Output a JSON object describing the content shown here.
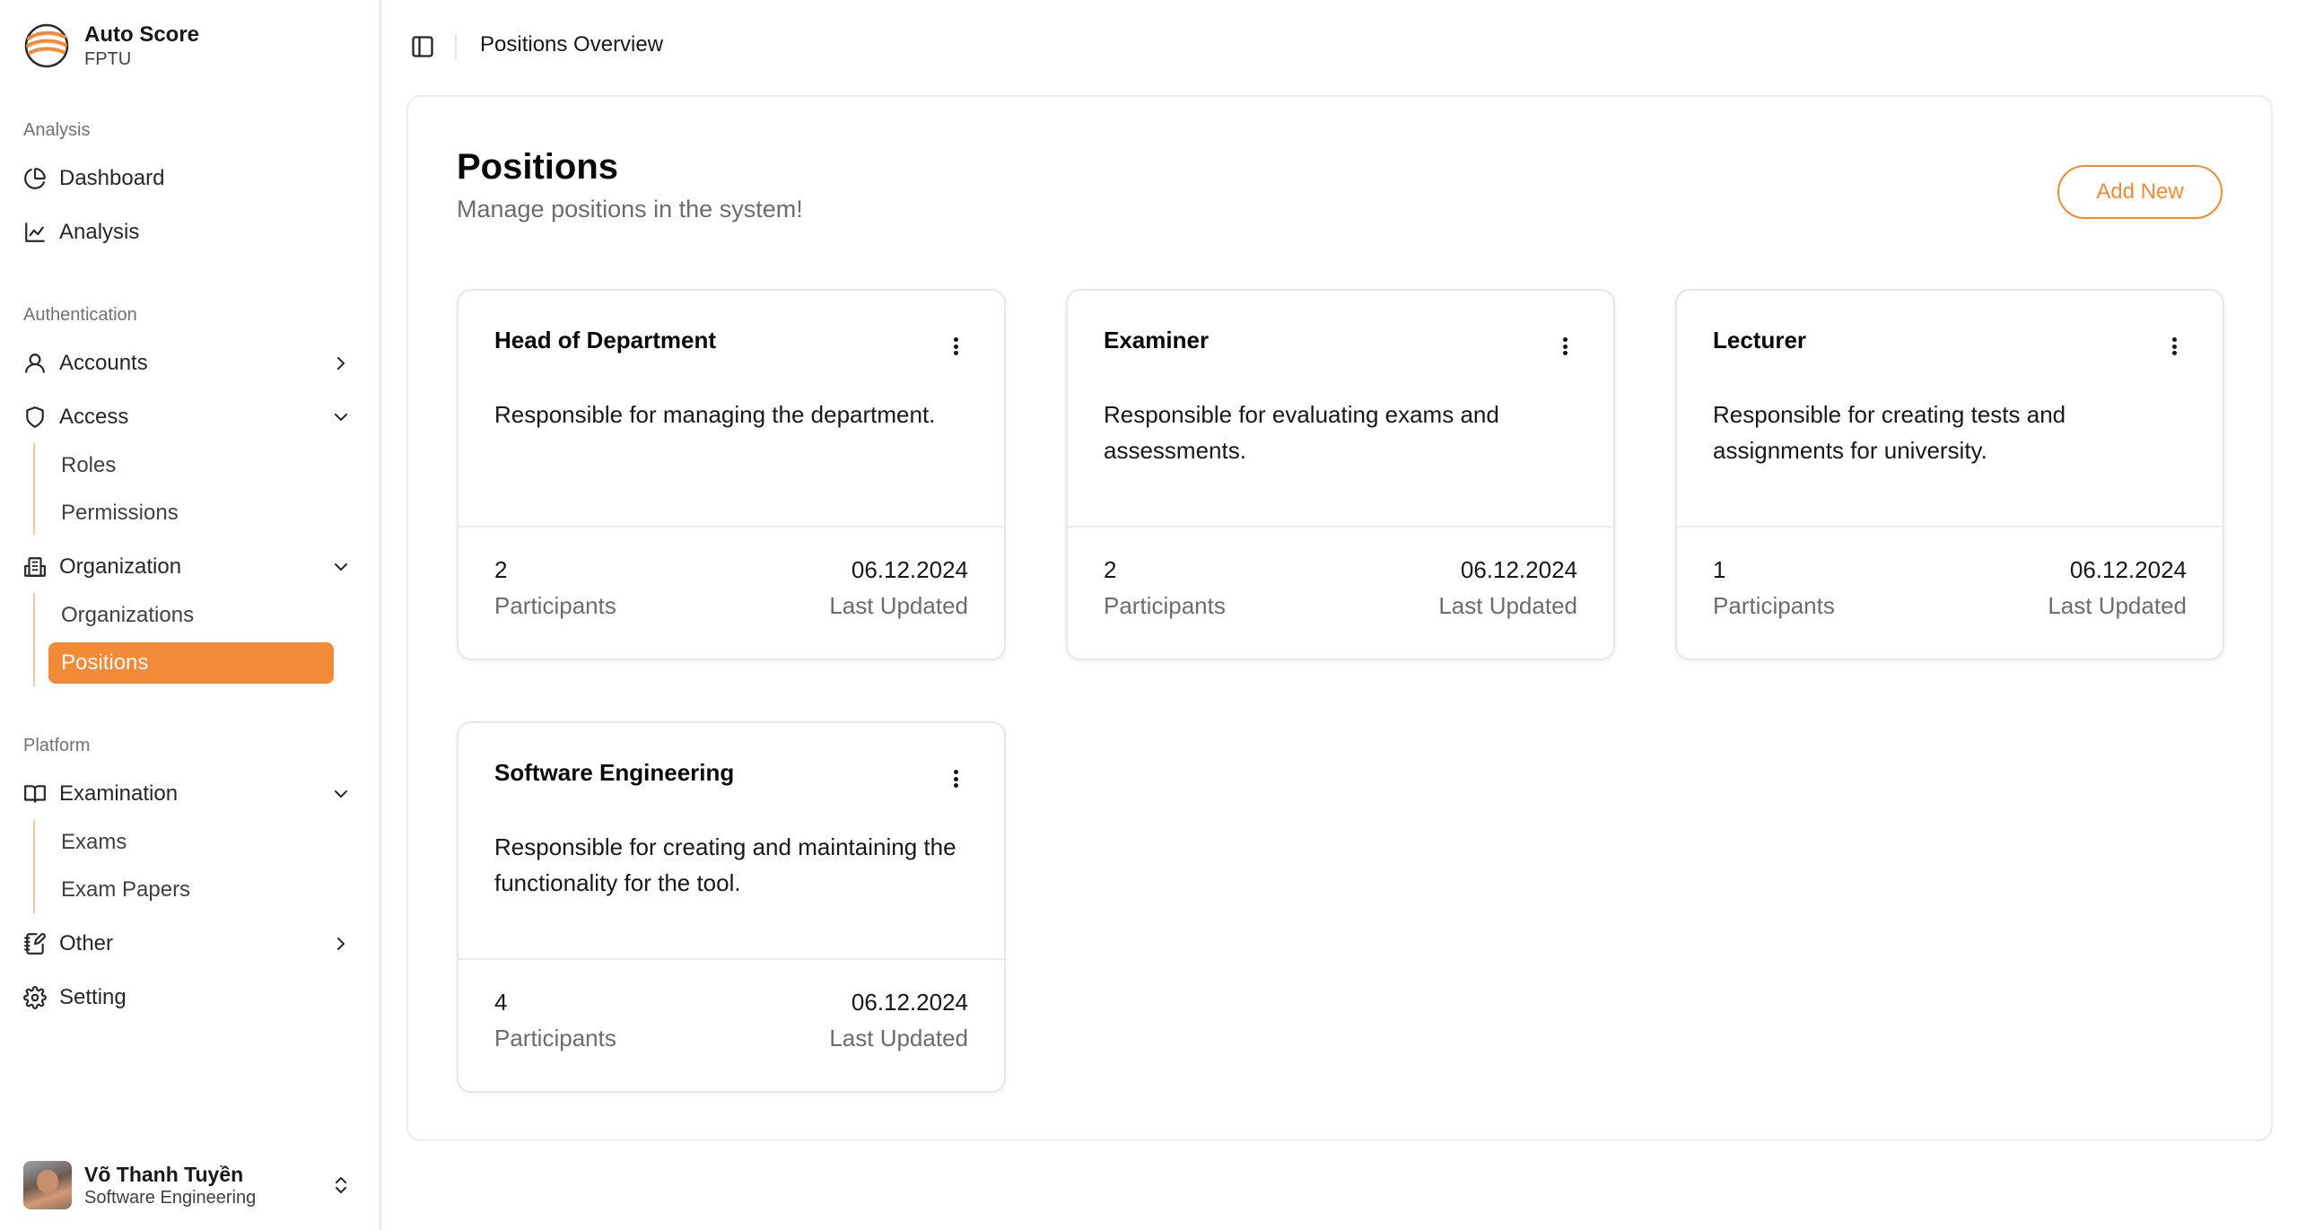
{
  "brand": {
    "name": "Auto Score",
    "sub": "FPTU"
  },
  "sidebar": {
    "groups": {
      "analysis": "Analysis",
      "authentication": "Authentication",
      "platform": "Platform"
    },
    "items": {
      "dashboard": "Dashboard",
      "analysis": "Analysis",
      "accounts": "Accounts",
      "access": "Access",
      "roles": "Roles",
      "permissions": "Permissions",
      "organization": "Organization",
      "organizations": "Organizations",
      "positions": "Positions",
      "examination": "Examination",
      "exams": "Exams",
      "exam_papers": "Exam Papers",
      "other": "Other",
      "setting": "Setting"
    },
    "active_item": "positions",
    "accent_color": "#f28a38"
  },
  "user": {
    "name": "Võ Thanh Tuyền",
    "role": "Software Engineering"
  },
  "header": {
    "breadcrumb": "Positions Overview"
  },
  "main": {
    "title": "Positions",
    "subtitle": "Manage positions in the system!",
    "add_button": "Add New",
    "cards": [
      {
        "title": "Head of Department",
        "description": "Responsible for managing the department.",
        "count": "2",
        "count_label": "Participants",
        "date": "06.12.2024",
        "date_label": "Last Updated"
      },
      {
        "title": "Examiner",
        "description": "Responsible for evaluating exams and assessments.",
        "count": "2",
        "count_label": "Participants",
        "date": "06.12.2024",
        "date_label": "Last Updated"
      },
      {
        "title": "Lecturer",
        "description": "Responsible for creating tests and assignments for university.",
        "count": "1",
        "count_label": "Participants",
        "date": "06.12.2024",
        "date_label": "Last Updated"
      },
      {
        "title": "Software Engineering",
        "description": "Responsible for creating and maintaining the functionality for the tool.",
        "count": "4",
        "count_label": "Participants",
        "date": "06.12.2024",
        "date_label": "Last Updated"
      }
    ]
  }
}
